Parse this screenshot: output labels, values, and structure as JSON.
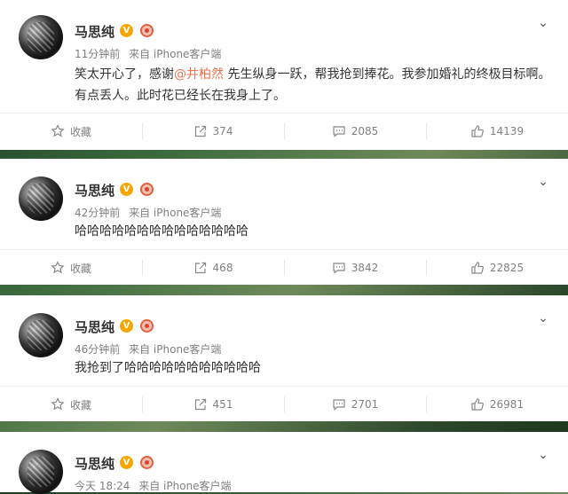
{
  "posts": [
    {
      "author": "马思纯",
      "time": "11分钟前",
      "source": "来自 iPhone客户端",
      "text_before": "笑太开心了，感谢",
      "mention": "@井柏然",
      "text_after": " 先生纵身一跃，帮我抢到捧花。我参加婚礼的终极目标啊。有点丢人。此时花已经长在我身上了。",
      "favorite_label": "收藏",
      "reposts": "374",
      "comments": "2085",
      "likes": "14139"
    },
    {
      "author": "马思纯",
      "time": "42分钟前",
      "source": "来自 iPhone客户端",
      "text": "哈哈哈哈哈哈哈哈哈哈哈哈哈哈",
      "favorite_label": "收藏",
      "reposts": "468",
      "comments": "3842",
      "likes": "22825"
    },
    {
      "author": "马思纯",
      "time": "46分钟前",
      "source": "来自 iPhone客户端",
      "text": "我抢到了哈哈哈哈哈哈哈哈哈哈哈",
      "favorite_label": "收藏",
      "reposts": "451",
      "comments": "2701",
      "likes": "26981"
    },
    {
      "author": "马思纯",
      "time": "今天 18:24",
      "source": "来自 iPhone客户端"
    }
  ],
  "badges": {
    "verified": "V"
  },
  "icons": {
    "favorite": "star-icon",
    "repost": "repost-icon",
    "comment": "comment-icon",
    "like": "thumbs-up-icon",
    "more": "chevron-down-icon"
  },
  "colors": {
    "mention": "#eb7350",
    "verified": "#f7a600",
    "meta": "#808080"
  }
}
